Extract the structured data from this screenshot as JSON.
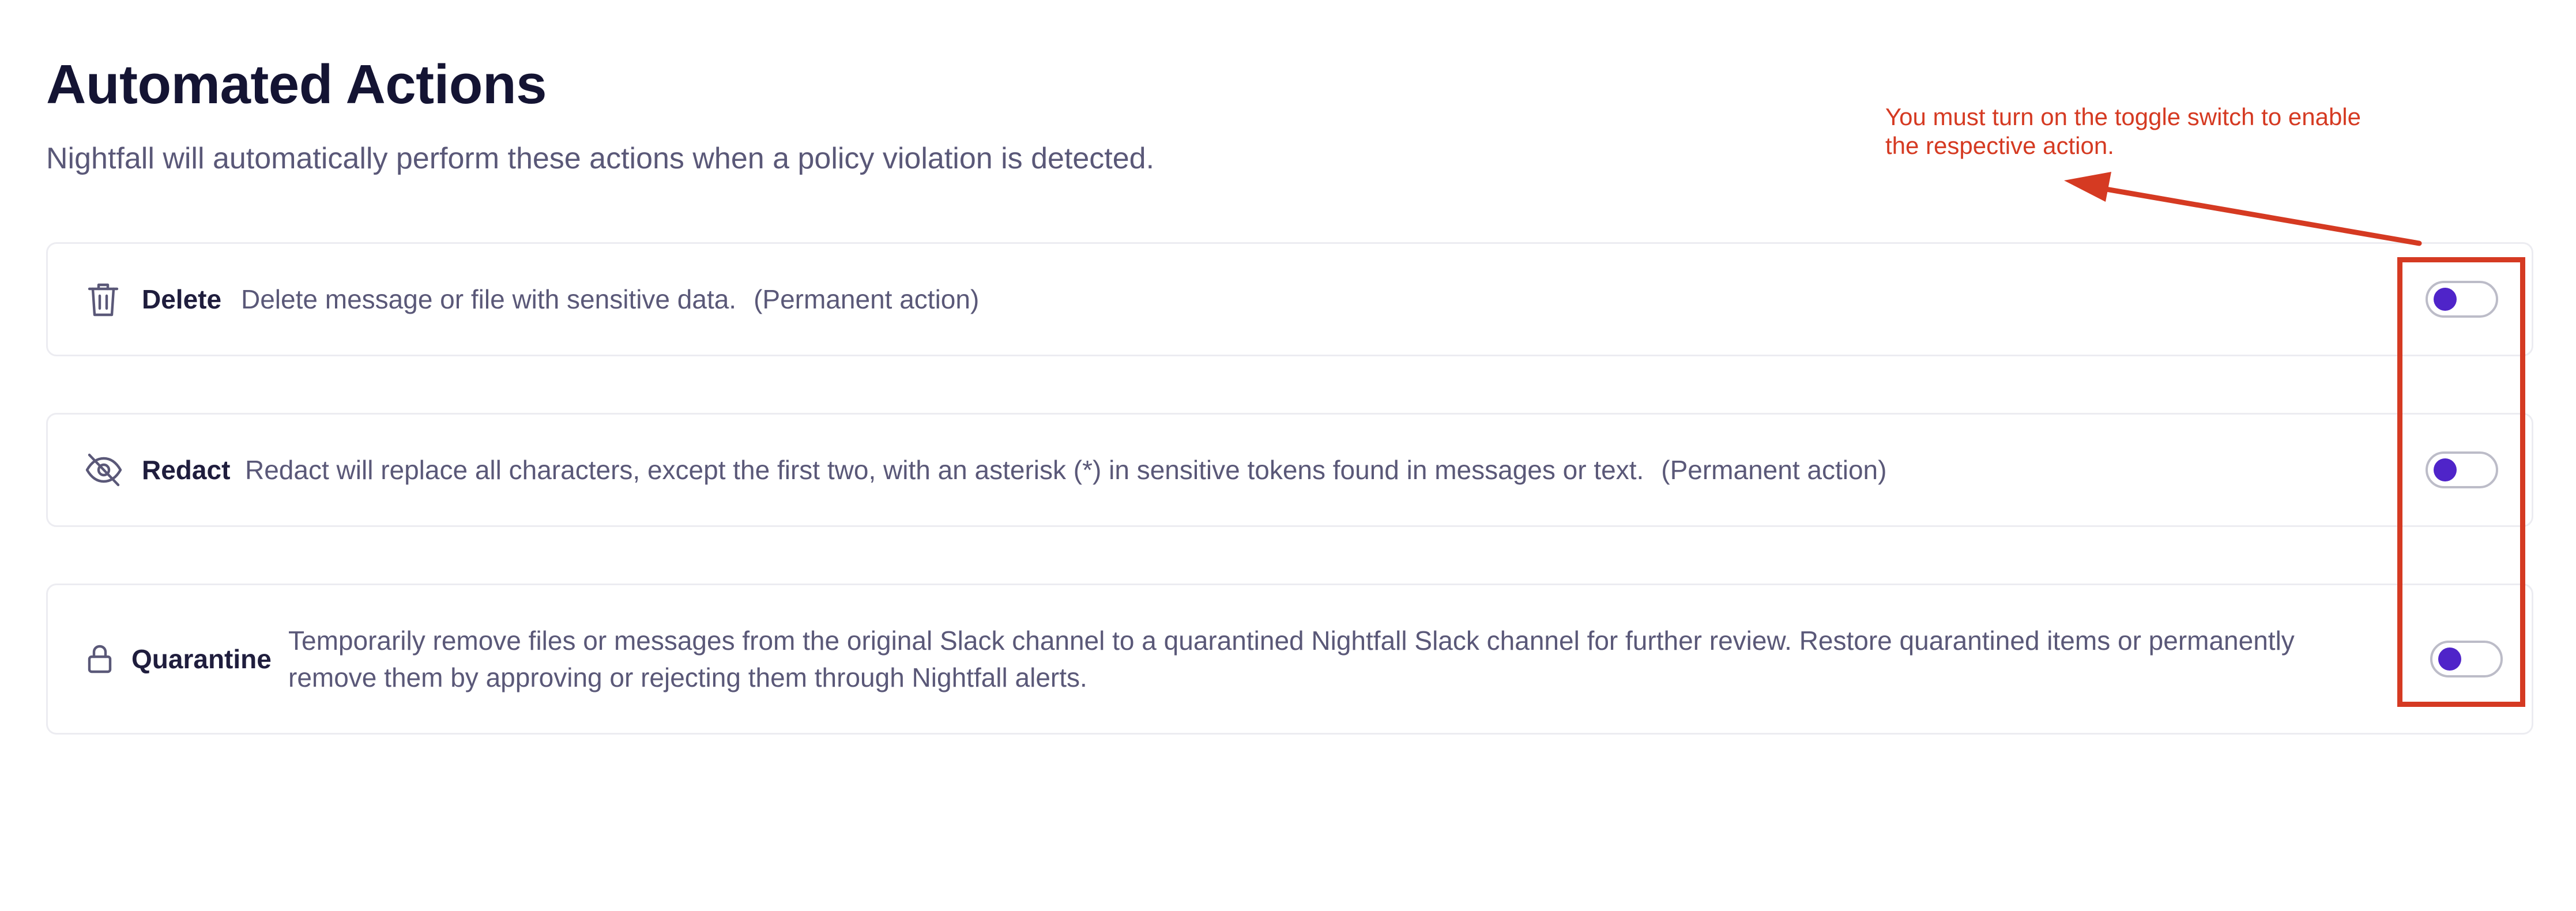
{
  "header": {
    "title": "Automated Actions",
    "subtitle": "Nightfall will automatically perform these actions when a policy violation is detected."
  },
  "colors": {
    "title": "#141433",
    "text_muted": "#5a5878",
    "toggle_knob": "#4f24c9",
    "toggle_border": "#bcbcc8",
    "card_border": "#ececf1",
    "annotation_red": "#d53a22"
  },
  "actions": [
    {
      "name": "Delete",
      "icon": "trash-icon",
      "description": "Delete message or file with sensitive data.",
      "note": "(Permanent action)",
      "toggle_on": false
    },
    {
      "name": "Redact",
      "icon": "eye-off-icon",
      "description": "Redact will replace all characters, except the first two, with an asterisk (*) in sensitive tokens found in messages or text.",
      "note": "(Permanent action)",
      "toggle_on": false
    },
    {
      "name": "Quarantine",
      "icon": "lock-icon",
      "description": "Temporarily remove files or messages from the original Slack channel to a quarantined Nightfall Slack channel for further review. Restore quarantined items or permanently remove them by approving or rejecting them through Nightfall alerts.",
      "note": "",
      "toggle_on": false
    }
  ],
  "annotation": {
    "text": "You must turn on the toggle switch to enable\nthe respective action."
  }
}
